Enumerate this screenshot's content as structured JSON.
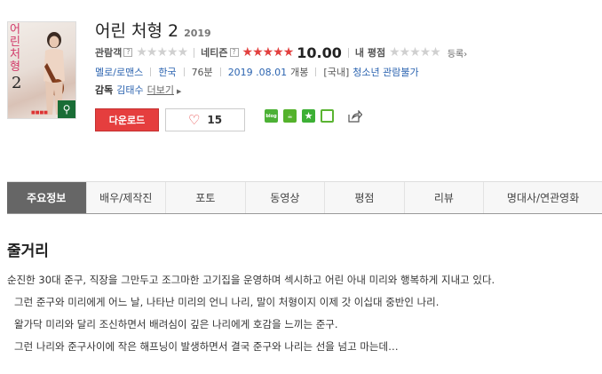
{
  "poster": {
    "title_text": "어린처형",
    "number_text": "2"
  },
  "movie": {
    "title": "어린 처형 2",
    "year": "2019"
  },
  "ratings": {
    "audience_label": "관람객",
    "help_icon": "?",
    "audience_stars": "★★★★★",
    "netizen_label": "네티즌",
    "netizen_stars": "★★★★★",
    "netizen_score": "10.00",
    "my_rating_label": "내 평점",
    "my_rating_stars": "★★★★★",
    "register_label": "등록"
  },
  "meta": {
    "genre": "멜로/로맨스",
    "country": "한국",
    "runtime": "76분",
    "release_date": "2019 .08.01",
    "release_suffix": "개봉",
    "rating_prefix": "[국내]",
    "rating": "청소년 관람불가"
  },
  "director": {
    "label": "감독",
    "name": "김태수",
    "more_label": "더보기"
  },
  "actions": {
    "download_label": "다운로드",
    "like_count": "15"
  },
  "tabs": [
    {
      "label": "주요정보"
    },
    {
      "label": "배우/제작진"
    },
    {
      "label": "포토"
    },
    {
      "label": "동영상"
    },
    {
      "label": "평점"
    },
    {
      "label": "리뷰"
    },
    {
      "label": "명대사/연관영화"
    }
  ],
  "synopsis": {
    "title": "줄거리",
    "lines": [
      "순진한 30대 준구, 직장을 그만두고 조그마한 고기집을 운영하며 섹시하고 어린 아내 미리와 행복하게 지내고 있다.",
      "그런 준구와 미리에게 어느 날, 나타난 미리의 언니 나리, 말이 처형이지 이제 갓 이십대 중반인 나리.",
      "왈가닥 미리와 달리 조신하면서 배려심이 깊은 나리에게 호감을 느끼는 준구.",
      "그런 나리와 준구사이에 작은 해프닝이 발생하면서 결국 준구와 나리는 선을 넘고 마는데…"
    ]
  },
  "colors": {
    "accent_red": "#e53e3e",
    "link_blue": "#2c64b0",
    "active_tab": "#666666"
  }
}
